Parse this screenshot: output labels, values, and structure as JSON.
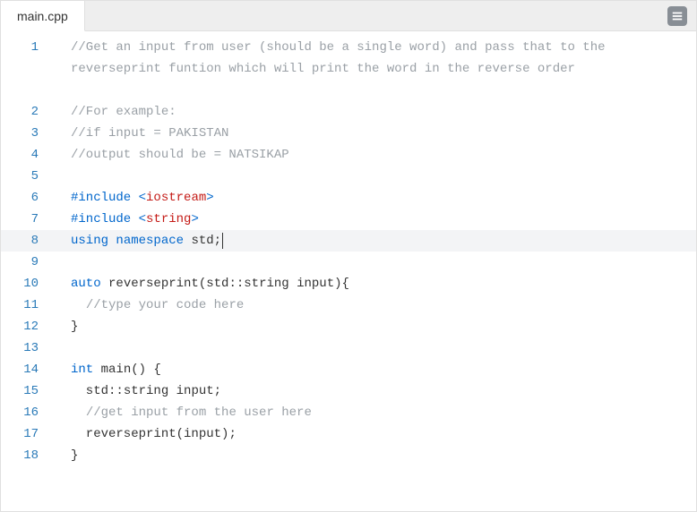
{
  "tabs": [
    {
      "label": "main.cpp",
      "active": true
    }
  ],
  "active_line": 8,
  "code_lines": [
    {
      "n": 1,
      "wrap": true,
      "tokens": [
        {
          "cls": "tok-comment",
          "t": "//Get an input from user (should be a single word) and pass that to the reverseprint funtion which will print the word in the reverse order"
        }
      ]
    },
    {
      "n": 2,
      "tokens": [
        {
          "cls": "tok-comment",
          "t": "//For example:"
        }
      ]
    },
    {
      "n": 3,
      "tokens": [
        {
          "cls": "tok-comment",
          "t": "//if input = PAKISTAN"
        }
      ]
    },
    {
      "n": 4,
      "tokens": [
        {
          "cls": "tok-comment",
          "t": "//output should be = NATSIKAP"
        }
      ]
    },
    {
      "n": 5,
      "tokens": []
    },
    {
      "n": 6,
      "tokens": [
        {
          "cls": "tok-preproc",
          "t": "#include "
        },
        {
          "cls": "tok-angle",
          "t": "<"
        },
        {
          "cls": "tok-include",
          "t": "iostream"
        },
        {
          "cls": "tok-angle",
          "t": ">"
        }
      ]
    },
    {
      "n": 7,
      "tokens": [
        {
          "cls": "tok-preproc",
          "t": "#include "
        },
        {
          "cls": "tok-angle",
          "t": "<"
        },
        {
          "cls": "tok-include",
          "t": "string"
        },
        {
          "cls": "tok-angle",
          "t": ">"
        }
      ]
    },
    {
      "n": 8,
      "tokens": [
        {
          "cls": "tok-keyword",
          "t": "using "
        },
        {
          "cls": "tok-keyword",
          "t": "namespace "
        },
        {
          "cls": "",
          "t": "std"
        },
        {
          "cls": "tok-punct",
          "t": ";"
        }
      ]
    },
    {
      "n": 9,
      "tokens": []
    },
    {
      "n": 10,
      "tokens": [
        {
          "cls": "tok-keyword",
          "t": "auto "
        },
        {
          "cls": "tok-func",
          "t": "reverseprint"
        },
        {
          "cls": "tok-punct",
          "t": "("
        },
        {
          "cls": "",
          "t": "std"
        },
        {
          "cls": "tok-punct",
          "t": "::"
        },
        {
          "cls": "",
          "t": "string input"
        },
        {
          "cls": "tok-punct",
          "t": "){"
        }
      ]
    },
    {
      "n": 11,
      "tokens": [
        {
          "cls": "",
          "t": "  "
        },
        {
          "cls": "tok-comment",
          "t": "//type your code here"
        }
      ]
    },
    {
      "n": 12,
      "tokens": [
        {
          "cls": "tok-punct",
          "t": "}"
        }
      ]
    },
    {
      "n": 13,
      "tokens": []
    },
    {
      "n": 14,
      "tokens": [
        {
          "cls": "tok-keyword",
          "t": "int "
        },
        {
          "cls": "tok-func",
          "t": "main"
        },
        {
          "cls": "tok-punct",
          "t": "() {"
        }
      ]
    },
    {
      "n": 15,
      "tokens": [
        {
          "cls": "",
          "t": "  std"
        },
        {
          "cls": "tok-punct",
          "t": "::"
        },
        {
          "cls": "",
          "t": "string input"
        },
        {
          "cls": "tok-punct",
          "t": ";"
        }
      ]
    },
    {
      "n": 16,
      "tokens": [
        {
          "cls": "",
          "t": "  "
        },
        {
          "cls": "tok-comment",
          "t": "//get input from the user here"
        }
      ]
    },
    {
      "n": 17,
      "tokens": [
        {
          "cls": "",
          "t": "  reverseprint"
        },
        {
          "cls": "tok-punct",
          "t": "("
        },
        {
          "cls": "",
          "t": "input"
        },
        {
          "cls": "tok-punct",
          "t": ");"
        }
      ]
    },
    {
      "n": 18,
      "tokens": [
        {
          "cls": "tok-punct",
          "t": "}"
        }
      ]
    }
  ]
}
